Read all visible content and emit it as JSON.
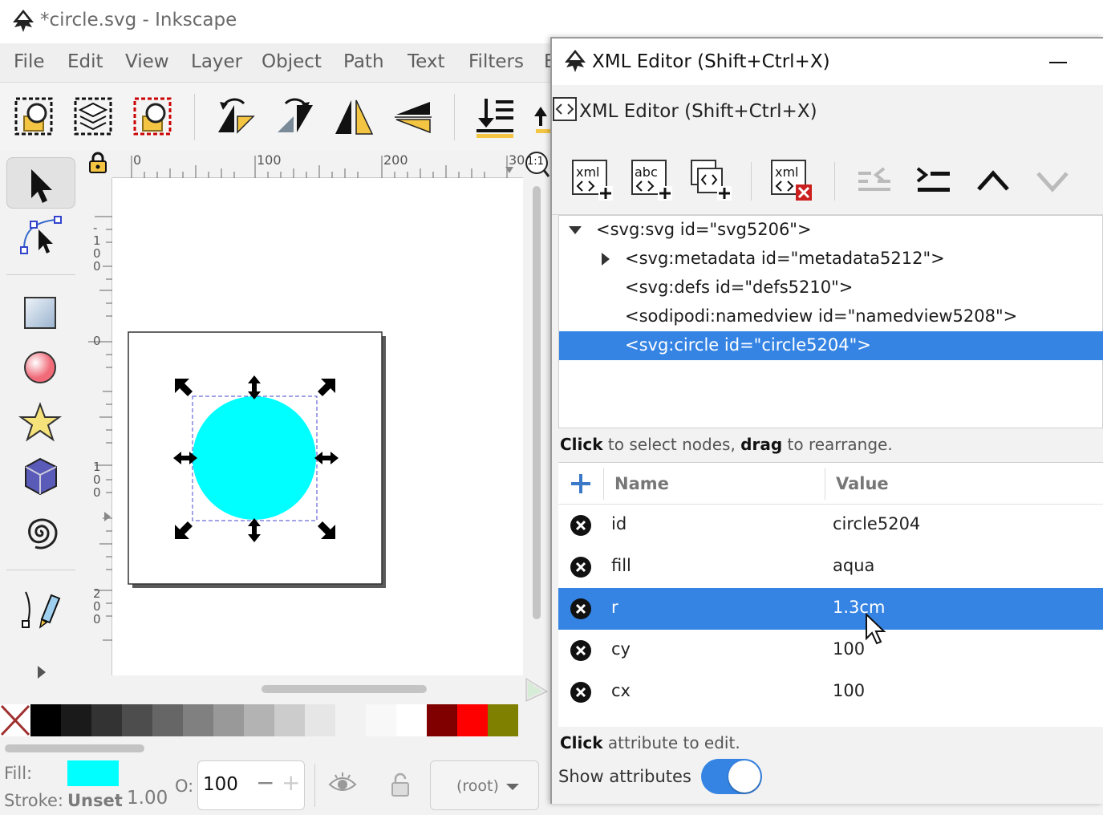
{
  "window": {
    "title": "*circle.svg - Inkscape"
  },
  "menu": [
    "File",
    "Edit",
    "View",
    "Layer",
    "Object",
    "Path",
    "Text",
    "Filters",
    "E"
  ],
  "ruler": {
    "horizontal": [
      "0",
      "100",
      "200",
      "30"
    ],
    "vertical": [
      "-100",
      "0",
      "100",
      "200"
    ],
    "zoom_button": "1:1"
  },
  "canvas": {
    "circle_fill": "#00ffff"
  },
  "palette": [
    "#000000",
    "#1a1a1a",
    "#333333",
    "#4d4d4d",
    "#666666",
    "#808080",
    "#999999",
    "#b3b3b3",
    "#cccccc",
    "#e6e6e6",
    "#f2f2f2",
    "#f8f8f8",
    "#ffffff",
    "#800000",
    "#ff0000",
    "#808000"
  ],
  "status": {
    "fill_label": "Fill:",
    "fill_color": "#00ffff",
    "stroke_label": "Stroke:",
    "stroke_value": "Unset",
    "stroke_width": "1.00",
    "opacity_label": "O:",
    "opacity_value": "100",
    "layer": "(root)"
  },
  "xml_editor": {
    "title": "XML Editor (Shift+Ctrl+X)",
    "tab_title": "XML Editor (Shift+Ctrl+X)",
    "tree": [
      "<svg:svg id=\"svg5206\">",
      "<svg:metadata id=\"metadata5212\">",
      "<svg:defs id=\"defs5210\">",
      "<sodipodi:namedview id=\"namedview5208\">",
      "<svg:circle id=\"circle5204\">"
    ],
    "hint_nodes_bold1": "Click",
    "hint_nodes_mid": " to select nodes, ",
    "hint_nodes_bold2": "drag",
    "hint_nodes_end": " to rearrange.",
    "col_name": "Name",
    "col_value": "Value",
    "attributes": [
      {
        "name": "id",
        "value": "circle5204"
      },
      {
        "name": "fill",
        "value": "aqua"
      },
      {
        "name": "r",
        "value": "1.3cm"
      },
      {
        "name": "cy",
        "value": "100"
      },
      {
        "name": "cx",
        "value": "100"
      }
    ],
    "hint_attr_bold": "Click",
    "hint_attr_end": " attribute to edit.",
    "show_attributes": "Show attributes"
  }
}
